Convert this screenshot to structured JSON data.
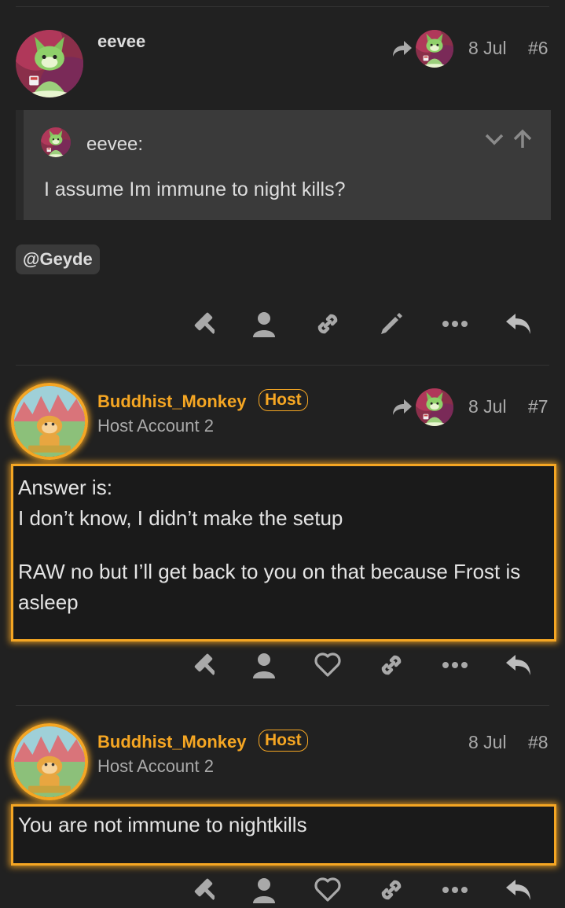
{
  "posts": [
    {
      "username": "eevee",
      "date": "8 Jul",
      "number": "#6",
      "quote": {
        "username": "eevee:",
        "text": "I assume Im immune to night kills?"
      },
      "mention": "@Geyde"
    },
    {
      "username": "Buddhist_Monkey",
      "flair": "Host",
      "subtitle": "Host Account 2",
      "date": "8 Jul",
      "number": "#7",
      "body": [
        "Answer is:",
        "I don’t know, I didn’t make the setup",
        "RAW no but I’ll get back to you on that because Frost is asleep"
      ]
    },
    {
      "username": "Buddhist_Monkey",
      "flair": "Host",
      "subtitle": "Host Account 2",
      "date": "8 Jul",
      "number": "#8",
      "body": [
        "You are not immune to nightkills"
      ]
    }
  ],
  "icons": {
    "post1_actions": [
      "gavel-icon",
      "user-icon",
      "link-icon",
      "pencil-icon",
      "ellipsis-icon",
      "reply-icon"
    ],
    "post2_actions": [
      "gavel-icon",
      "user-icon",
      "heart-icon",
      "link-icon",
      "ellipsis-icon",
      "reply-icon"
    ],
    "post3_actions": [
      "gavel-icon",
      "user-icon",
      "heart-icon",
      "link-icon",
      "ellipsis-icon",
      "reply-icon"
    ]
  },
  "colors": {
    "background": "#212121",
    "accent": "#f5a623",
    "text": "#dddddd",
    "muted": "#aaaaaa",
    "quote_background": "#3a3a3a"
  }
}
